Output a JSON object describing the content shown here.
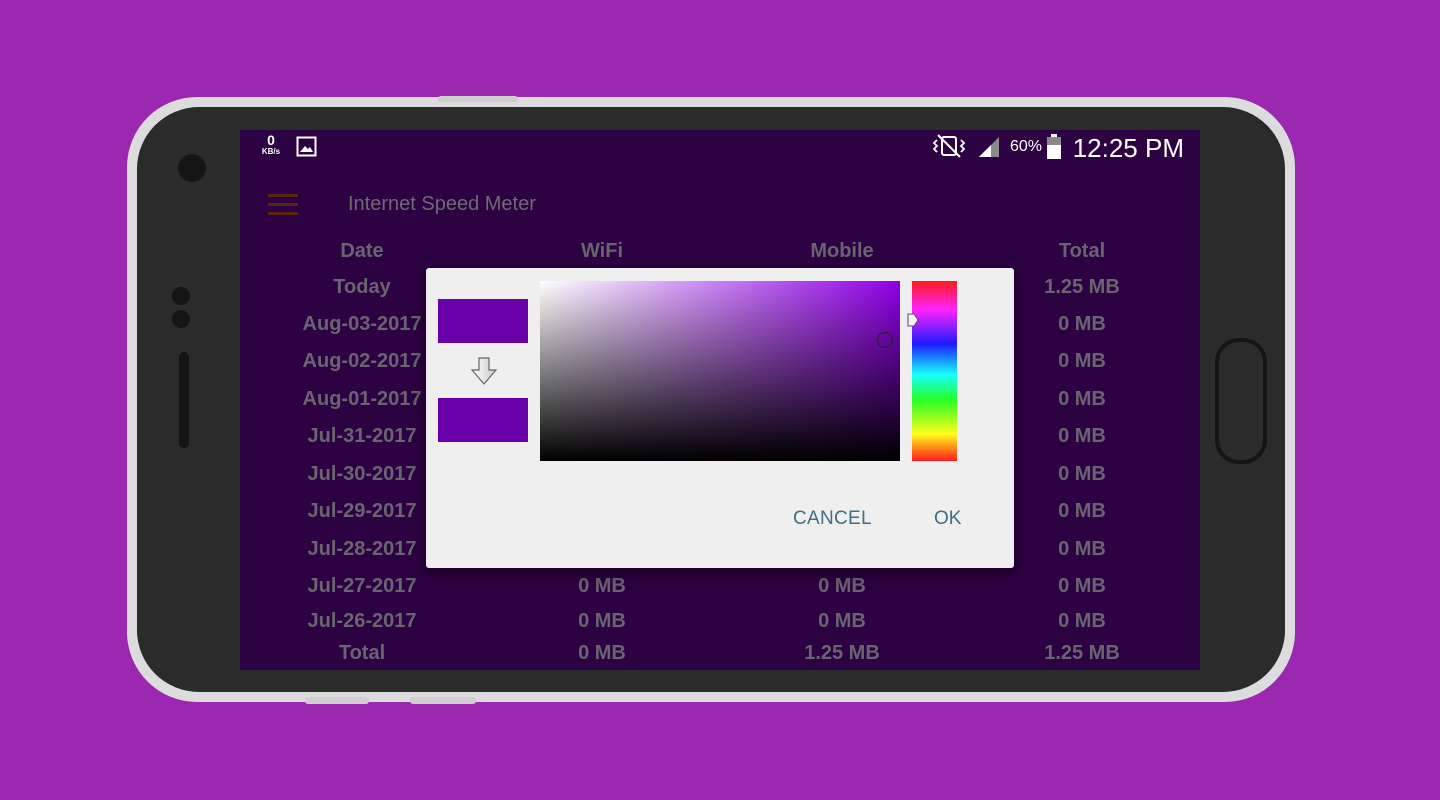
{
  "statusbar": {
    "speed_value": "0",
    "speed_unit": "KB/s",
    "battery_percent": "60%",
    "time": "12:25 PM",
    "icons": [
      "image-icon",
      "vibrate-mute-icon",
      "signal-icon",
      "battery-icon"
    ]
  },
  "appbar": {
    "title": "Internet Speed Meter",
    "menu_icon": "hamburger-menu-icon"
  },
  "table": {
    "headers": [
      "Date",
      "WiFi",
      "Mobile",
      "Total"
    ],
    "rows": [
      [
        "Today",
        "",
        "",
        "1.25 MB"
      ],
      [
        "Aug-03-2017",
        "",
        "",
        "0 MB"
      ],
      [
        "Aug-02-2017",
        "",
        "",
        "0 MB"
      ],
      [
        "Aug-01-2017",
        "",
        "",
        "0 MB"
      ],
      [
        "Jul-31-2017",
        "",
        "",
        "0 MB"
      ],
      [
        "Jul-30-2017",
        "",
        "",
        "0 MB"
      ],
      [
        "Jul-29-2017",
        "",
        "",
        "0 MB"
      ],
      [
        "Jul-28-2017",
        "",
        "",
        "0 MB"
      ],
      [
        "Jul-27-2017",
        "0 MB",
        "0 MB",
        "0 MB"
      ],
      [
        "Jul-26-2017",
        "0 MB",
        "0 MB",
        "0 MB"
      ]
    ],
    "total": [
      "Total",
      "0 MB",
      "1.25 MB",
      "1.25 MB"
    ]
  },
  "dialog": {
    "cancel_label": "CANCEL",
    "ok_label": "OK",
    "old_color": "#6a00a8",
    "new_color": "#6a00a8",
    "hue_color": "#8f00e6"
  },
  "colors": {
    "background": "#9c27b0",
    "screen": "#2d0242",
    "button_text": "#3e6f82"
  }
}
